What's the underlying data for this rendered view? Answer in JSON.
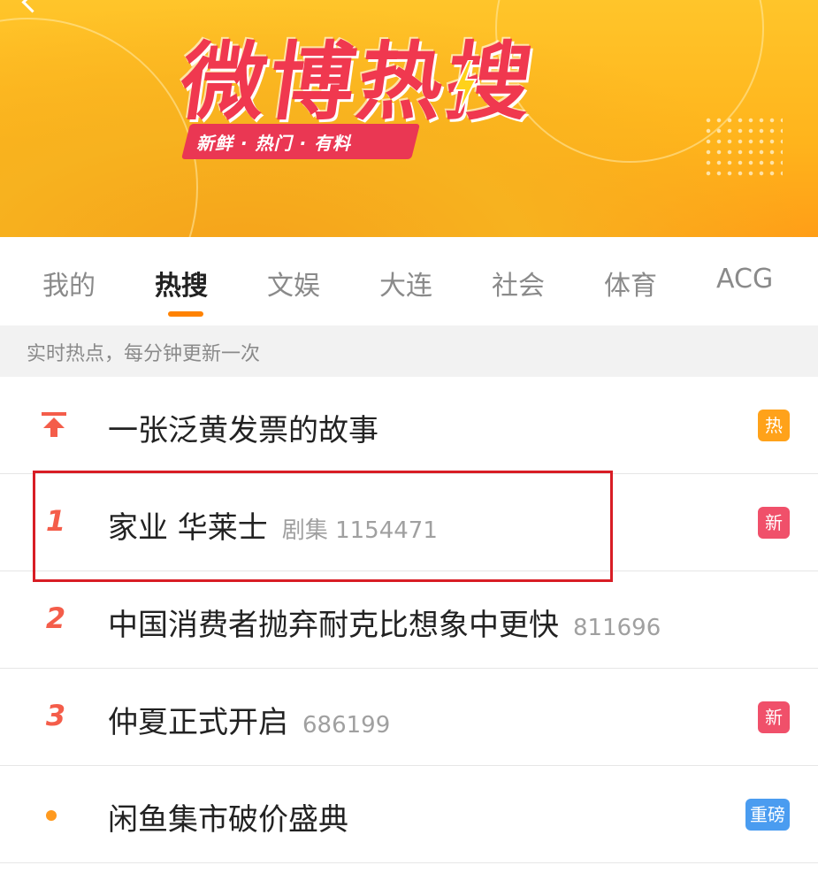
{
  "banner": {
    "logo_title": "微博热搜",
    "slogan": "新鲜 · 热门 · 有料"
  },
  "tabs": [
    {
      "label": "我的"
    },
    {
      "label": "热搜"
    },
    {
      "label": "文娱"
    },
    {
      "label": "大连"
    },
    {
      "label": "社会"
    },
    {
      "label": "体育"
    },
    {
      "label": "ACG"
    }
  ],
  "notice": "实时热点，每分钟更新一次",
  "list": [
    {
      "rank": "",
      "title": "一张泛黄发票的故事",
      "meta": "",
      "badge": "热"
    },
    {
      "rank": "1",
      "title": "家业 华莱士",
      "meta": "剧集 1154471",
      "badge": "新"
    },
    {
      "rank": "2",
      "title": "中国消费者抛弃耐克比想象中更快",
      "meta": "811696",
      "badge": ""
    },
    {
      "rank": "3",
      "title": "仲夏正式开启",
      "meta": "686199",
      "badge": "新"
    },
    {
      "rank": "",
      "title": "闲鱼集市破价盛典",
      "meta": "",
      "badge": "重磅"
    }
  ],
  "colors": {
    "accent": "#ff8200",
    "rank": "#f45d4a",
    "badge_hot": "#ffa21a",
    "badge_new": "#f0506a",
    "badge_heavy": "#4a9cf0",
    "highlight_box": "#d81d25"
  }
}
